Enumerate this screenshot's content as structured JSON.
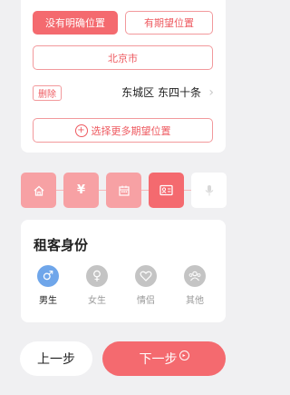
{
  "location": {
    "no_specific_label": "没有明确位置",
    "has_expected_label": "有期望位置",
    "city": "北京市",
    "delete_label": "删除",
    "address": "东城区 东四十条",
    "add_more_label": "选择更多期望位置"
  },
  "steps": [
    {
      "icon": "home-icon",
      "state": "done"
    },
    {
      "icon": "yen-icon",
      "state": "done"
    },
    {
      "icon": "calendar-icon",
      "state": "done"
    },
    {
      "icon": "id-card-icon",
      "state": "active"
    },
    {
      "icon": "microphone-icon",
      "state": "pending"
    }
  ],
  "identity": {
    "title": "租客身份",
    "options": [
      {
        "label": "男生",
        "icon": "male-icon",
        "selected": true
      },
      {
        "label": "女生",
        "icon": "female-icon",
        "selected": false
      },
      {
        "label": "情侣",
        "icon": "couple-heart-icon",
        "selected": false
      },
      {
        "label": "其他",
        "icon": "group-icon",
        "selected": false
      }
    ]
  },
  "nav": {
    "prev_label": "上一步",
    "next_label": "下一步"
  },
  "colors": {
    "accent": "#f46a6f",
    "accent_light": "#f7a1a4",
    "selected_blue": "#6fa6ea",
    "unselected_gray": "#c4c4c4"
  }
}
